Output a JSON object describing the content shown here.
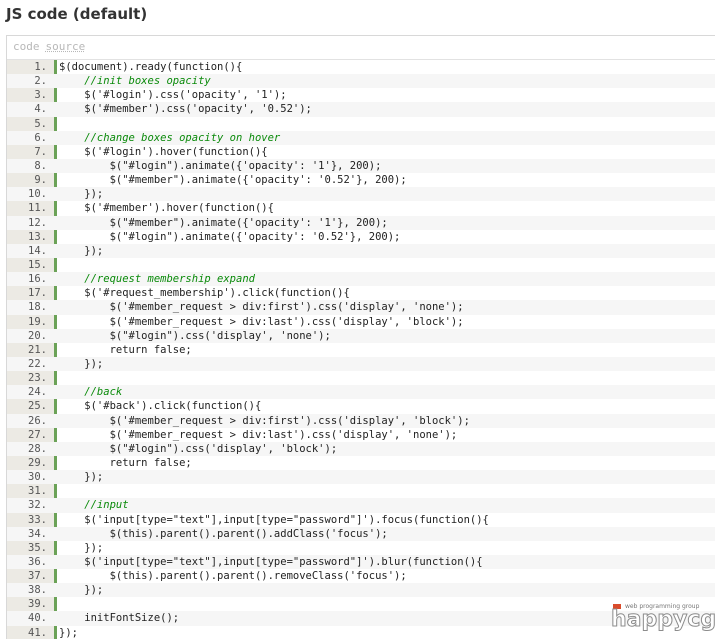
{
  "title": "JS code (default)",
  "toolbar": {
    "code_label": "code",
    "source_link": "source"
  },
  "lines": [
    {
      "n": "1.",
      "text": "$(document).ready(function(){",
      "comment": false
    },
    {
      "n": "2.",
      "text": "    //init boxes opacity",
      "comment": true
    },
    {
      "n": "3.",
      "text": "    $('#login').css('opacity', '1');",
      "comment": false
    },
    {
      "n": "4.",
      "text": "    $('#member').css('opacity', '0.52');",
      "comment": false
    },
    {
      "n": "5.",
      "text": "",
      "comment": false
    },
    {
      "n": "6.",
      "text": "    //change boxes opacity on hover",
      "comment": true
    },
    {
      "n": "7.",
      "text": "    $('#login').hover(function(){",
      "comment": false
    },
    {
      "n": "8.",
      "text": "        $(\"#login\").animate({'opacity': '1'}, 200);",
      "comment": false
    },
    {
      "n": "9.",
      "text": "        $(\"#member\").animate({'opacity': '0.52'}, 200);",
      "comment": false
    },
    {
      "n": "10.",
      "text": "    });",
      "comment": false
    },
    {
      "n": "11.",
      "text": "    $('#member').hover(function(){",
      "comment": false
    },
    {
      "n": "12.",
      "text": "        $(\"#member\").animate({'opacity': '1'}, 200);",
      "comment": false
    },
    {
      "n": "13.",
      "text": "        $(\"#login\").animate({'opacity': '0.52'}, 200);",
      "comment": false
    },
    {
      "n": "14.",
      "text": "    });",
      "comment": false
    },
    {
      "n": "15.",
      "text": "",
      "comment": false
    },
    {
      "n": "16.",
      "text": "    //request membership expand",
      "comment": true
    },
    {
      "n": "17.",
      "text": "    $('#request_membership').click(function(){",
      "comment": false
    },
    {
      "n": "18.",
      "text": "        $('#member_request > div:first').css('display', 'none');",
      "comment": false
    },
    {
      "n": "19.",
      "text": "        $('#member_request > div:last').css('display', 'block');",
      "comment": false
    },
    {
      "n": "20.",
      "text": "        $(\"#login\").css('display', 'none');",
      "comment": false
    },
    {
      "n": "21.",
      "text": "        return false;",
      "comment": false
    },
    {
      "n": "22.",
      "text": "    });",
      "comment": false
    },
    {
      "n": "23.",
      "text": "",
      "comment": false
    },
    {
      "n": "24.",
      "text": "    //back",
      "comment": true
    },
    {
      "n": "25.",
      "text": "    $('#back').click(function(){",
      "comment": false
    },
    {
      "n": "26.",
      "text": "        $('#member_request > div:first').css('display', 'block');",
      "comment": false
    },
    {
      "n": "27.",
      "text": "        $('#member_request > div:last').css('display', 'none');",
      "comment": false
    },
    {
      "n": "28.",
      "text": "        $(\"#login\").css('display', 'block');",
      "comment": false
    },
    {
      "n": "29.",
      "text": "        return false;",
      "comment": false
    },
    {
      "n": "30.",
      "text": "    });",
      "comment": false
    },
    {
      "n": "31.",
      "text": "",
      "comment": false
    },
    {
      "n": "32.",
      "text": "    //input",
      "comment": true
    },
    {
      "n": "33.",
      "text": "    $('input[type=\"text\"],input[type=\"password\"]').focus(function(){",
      "comment": false
    },
    {
      "n": "34.",
      "text": "        $(this).parent().parent().addClass('focus');",
      "comment": false
    },
    {
      "n": "35.",
      "text": "    });",
      "comment": false
    },
    {
      "n": "36.",
      "text": "    $('input[type=\"text\"],input[type=\"password\"]').blur(function(){",
      "comment": false
    },
    {
      "n": "37.",
      "text": "        $(this).parent().parent().removeClass('focus');",
      "comment": false
    },
    {
      "n": "38.",
      "text": "    });",
      "comment": false
    },
    {
      "n": "39.",
      "text": "",
      "comment": false
    },
    {
      "n": "40.",
      "text": "    initFontSize();",
      "comment": false
    },
    {
      "n": "41.",
      "text": "});",
      "comment": false
    }
  ],
  "watermark": {
    "tagline": "web programming group",
    "brand": "happycgi"
  },
  "colors": {
    "gutter_border": "#6ba257",
    "gutter_bg": "#eceae4",
    "comment": "#0a8a0a"
  }
}
